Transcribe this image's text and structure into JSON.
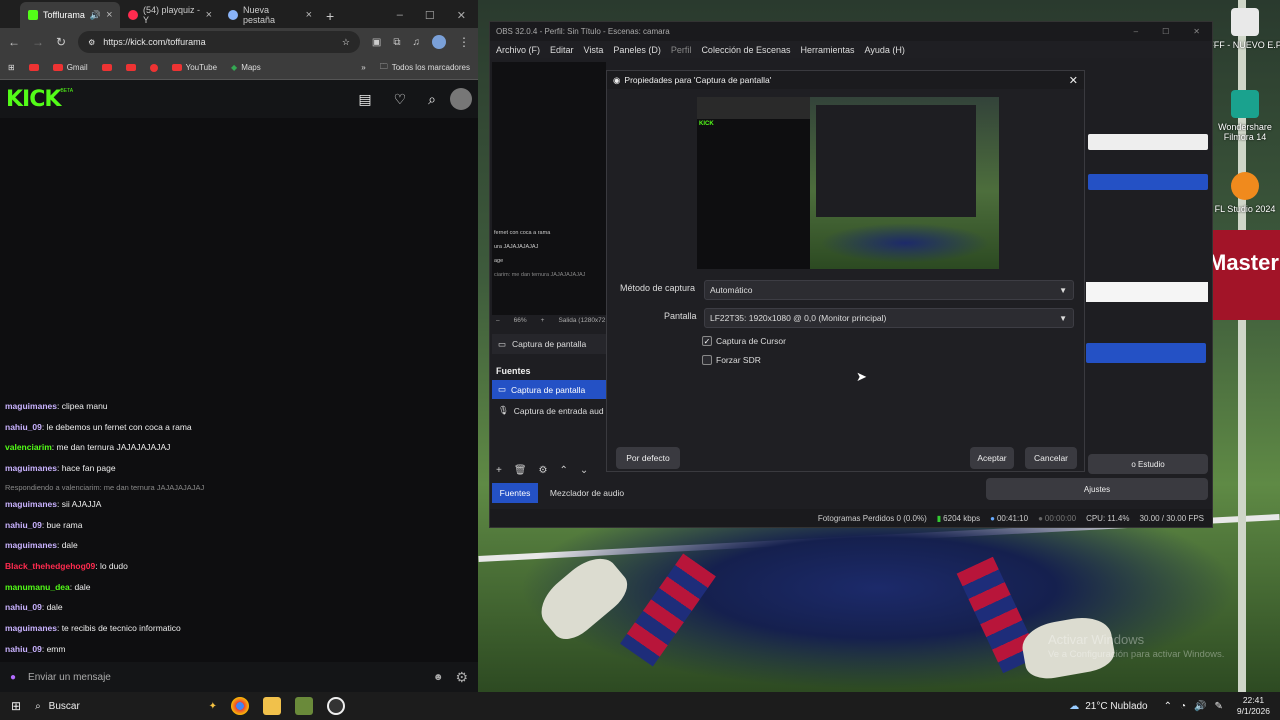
{
  "browser": {
    "tabs": [
      {
        "label": "Tofflurama",
        "color": "#53fc18"
      },
      {
        "label": "(54) playquiz - Y",
        "color": "#ff2b4f"
      },
      {
        "label": "Nueva pestaña",
        "color": "#8ab4f8"
      }
    ],
    "url": "https://kick.com/toffurama",
    "bookmarks": [
      "Gmail",
      "YouTube",
      "Maps",
      "Todos los marcadores"
    ]
  },
  "kick": {
    "logo": "KICK",
    "beta": "BETA",
    "chat_placeholder": "Enviar un mensaje",
    "messages": [
      {
        "user": "maguimanes",
        "text": ": clipea manu",
        "color": "#c9b2ff"
      },
      {
        "user": "nahiu_09",
        "text": ": le debemos un fernet con coca a rama",
        "color": "#c9b2ff"
      },
      {
        "user": "valenciarim",
        "text": ": me dan ternura JAJAJAJAJAJ",
        "color": "#53fc18"
      },
      {
        "user": "maguimanes",
        "text": ": hace fan page",
        "color": "#c9b2ff"
      },
      {
        "reply": "Respondiendo a valenciarim: me dan ternura JAJAJAJAJAJ"
      },
      {
        "user": "maguimanes",
        "text": ": sii AJAJJA",
        "color": "#c9b2ff"
      },
      {
        "user": "nahiu_09",
        "text": ": bue rama",
        "color": "#c9b2ff"
      },
      {
        "user": "maguimanes",
        "text": ": dale",
        "color": "#c9b2ff"
      },
      {
        "user": "Black_thehedgehog09",
        "text": ": lo dudo",
        "color": "#ff2b4f"
      },
      {
        "user": "manumanu_dea",
        "text": ": dale",
        "color": "#53fc18"
      },
      {
        "user": "nahiu_09",
        "text": ": dale",
        "color": "#c9b2ff"
      },
      {
        "user": "maguimanes",
        "text": ": te recibis de tecnico informatico",
        "color": "#c9b2ff"
      },
      {
        "user": "nahiu_09",
        "text": ": emm",
        "color": "#c9b2ff"
      }
    ]
  },
  "obs": {
    "title": "OBS 32.0.4 - Perfil: Sin Título - Escenas: camara",
    "menu": [
      "Archivo (F)",
      "Editar",
      "Vista",
      "Paneles (D)",
      "Perfil",
      "Colección de Escenas",
      "Herramientas",
      "Ayuda (H)"
    ],
    "chat_overlay": [
      "fernet con coca a rama",
      "ura JAJAJAJAJAJ",
      "age",
      "ciarim: me dan ternura JAJAJAJAJAJ"
    ],
    "zoom": "66%",
    "output": "Salida (1280x72",
    "scene_source": "Captura de pantalla",
    "sources_header": "Fuentes",
    "sources": [
      "Captura de pantalla",
      "Captura de entrada aud"
    ],
    "bottom_tabs": [
      "Fuentes",
      "Mezclador de audio"
    ],
    "right_buttons": [
      "Estudio",
      "Ajustes",
      "Cancelar",
      "o Estudio",
      "Ajustes"
    ],
    "status": {
      "dropped": "Fotogramas Perdidos 0 (0.0%)",
      "kbps": "6204 kbps",
      "rec_time": "00:41:10",
      "stream_time": "00:00:00",
      "cpu": "CPU: 11.4%",
      "fps": "30.00 / 30.00 FPS"
    }
  },
  "dialog": {
    "title": "Propiedades para 'Captura de pantalla'",
    "method_label": "Método de captura",
    "method_value": "Automático",
    "screen_label": "Pantalla",
    "screen_value": "LF22T35: 1920x1080 @ 0,0 (Monitor principal)",
    "cursor_label": "Captura de Cursor",
    "cursor_checked": true,
    "sdr_label": "Forzar SDR",
    "sdr_checked": false,
    "default_btn": "Por defecto",
    "ok_btn": "Aceptar",
    "cancel_btn": "Cancelar"
  },
  "desktop": {
    "icons": [
      "FFF - NUEVO E.P",
      "Wondershare Filmora 14",
      "FL Studio 2024"
    ],
    "activate_title": "Activar Windows",
    "activate_sub": "Ve a Configuración para activar Windows.",
    "brand": "Master"
  },
  "taskbar": {
    "search": "Buscar",
    "weather": "21°C Nublado",
    "time": "22:41",
    "date": "9/1/2026"
  }
}
